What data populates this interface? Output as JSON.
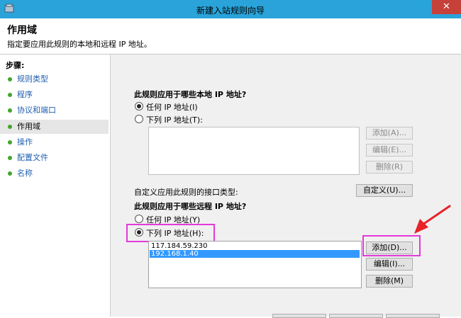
{
  "window": {
    "title": "新建入站规则向导",
    "close_label": "✕"
  },
  "header": {
    "title": "作用域",
    "description": "指定要应用此规则的本地和远程 IP 地址。"
  },
  "steps": {
    "title": "步骤:",
    "items": [
      {
        "label": "规则类型"
      },
      {
        "label": "程序"
      },
      {
        "label": "协议和端口"
      },
      {
        "label": "作用域",
        "active": true
      },
      {
        "label": "操作"
      },
      {
        "label": "配置文件"
      },
      {
        "label": "名称"
      }
    ]
  },
  "local": {
    "heading": "此规则应用于哪些本地 IP 地址?",
    "option_any": "任何 IP 地址(I)",
    "option_list": "下列 IP 地址(T):",
    "selected": "any",
    "add": "添加(A)...",
    "edit": "编辑(E)...",
    "remove": "删除(R)"
  },
  "interface": {
    "label": "自定义应用此规则的接口类型:",
    "button": "自定义(U)..."
  },
  "remote": {
    "heading": "此规则应用于哪些远程 IP 地址?",
    "option_any": "任何 IP 地址(Y)",
    "option_list": "下列 IP 地址(H):",
    "selected": "list",
    "addresses": [
      "117.184.59.230",
      "192.168.1.40"
    ],
    "selected_index": 1,
    "add": "添加(D)...",
    "edit": "编辑(I)...",
    "remove": "删除(M)"
  },
  "colors": {
    "titlebar": "#29a3d9",
    "close": "#c7413b",
    "highlight": "#e23ad9",
    "arrow": "#e8232a",
    "step_dot": "#41a62a",
    "link": "#1f5fb0"
  }
}
